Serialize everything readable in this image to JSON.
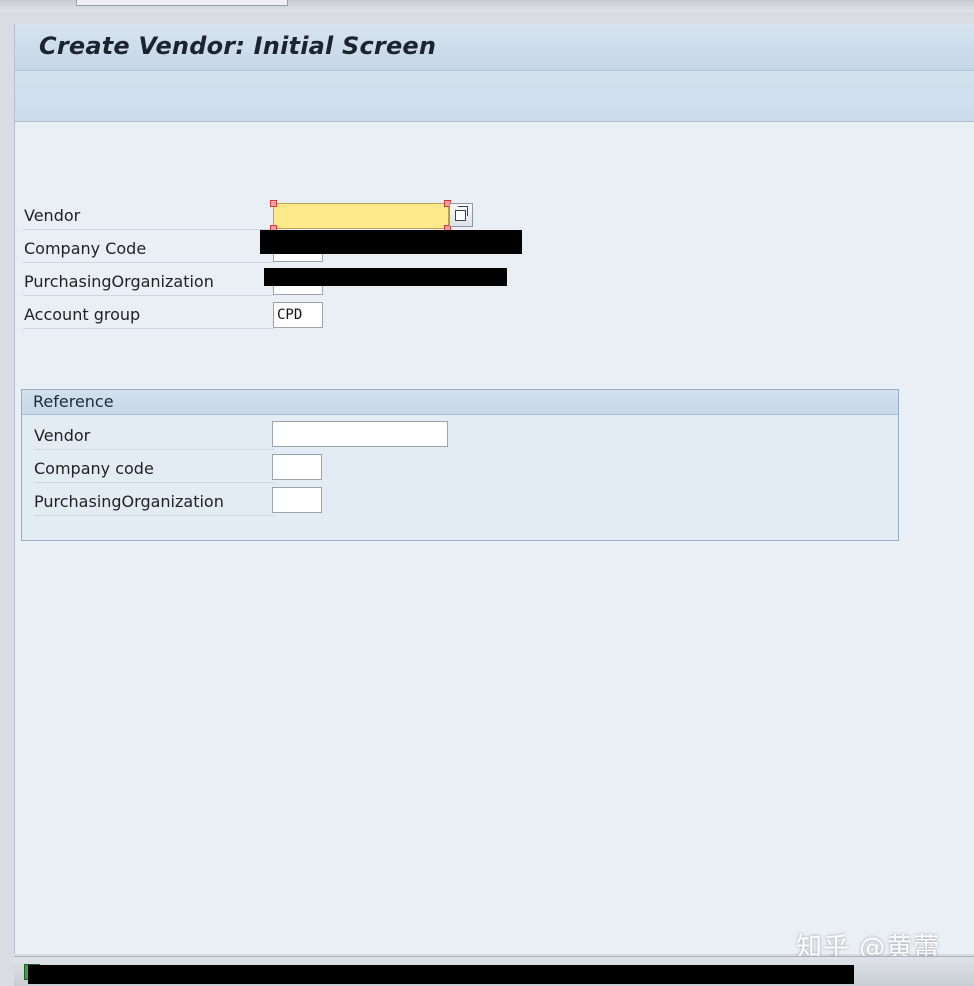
{
  "window": {
    "title": "Create Vendor: Initial Screen"
  },
  "main": {
    "fields": [
      {
        "label": "Vendor",
        "value": ""
      },
      {
        "label": "Company Code",
        "value": ""
      },
      {
        "label": "PurchasingOrganization",
        "value": ""
      },
      {
        "label": "Account group",
        "value": "CPD"
      }
    ]
  },
  "reference": {
    "title": "Reference",
    "fields": [
      {
        "label": "Vendor",
        "value": ""
      },
      {
        "label": "Company code",
        "value": ""
      },
      {
        "label": "PurchasingOrganization",
        "value": ""
      }
    ]
  },
  "colors": {
    "focus_field": "#fbe98a",
    "title_bar": "#c5d6e6",
    "background": "#eaeef5",
    "status_ok": "#3aa148"
  },
  "watermark": "知乎 @黄蕾"
}
